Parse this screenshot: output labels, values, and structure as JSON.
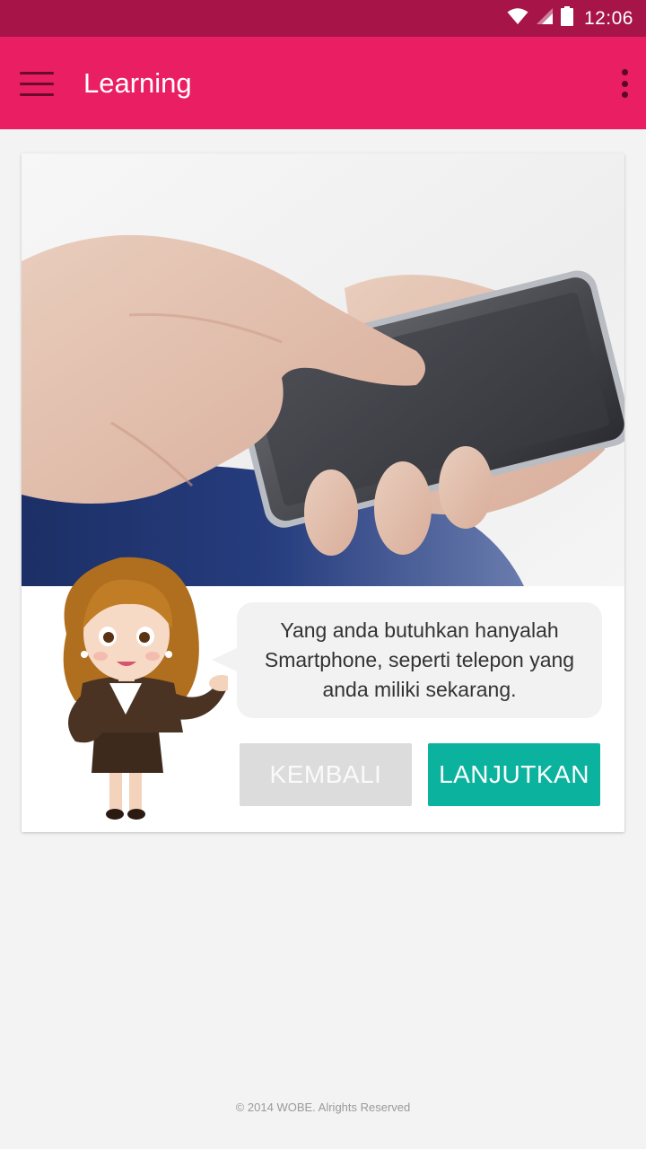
{
  "status_bar": {
    "time": "12:06",
    "icons": [
      "wifi-icon",
      "signal-icon",
      "battery-icon"
    ],
    "background": "#a71548"
  },
  "app_bar": {
    "title": "Learning",
    "background": "#ea1e63",
    "menu_icon": "hamburger-menu-icon",
    "overflow_icon": "more-vertical-icon"
  },
  "lesson": {
    "hero_image": "hands-holding-smartphone-photo",
    "avatar": "businesswoman-character-illustration",
    "message": "Yang anda butuhkan hanyalah Smartphone, seperti telepon yang anda miliki sekarang.",
    "back_label": "KEMBALI",
    "next_label": "LANJUTKAN",
    "back_color": "#dcdcdc",
    "next_color": "#0bb39f"
  },
  "footer": {
    "copyright": "© 2014 WOBE. Alrights Reserved"
  }
}
